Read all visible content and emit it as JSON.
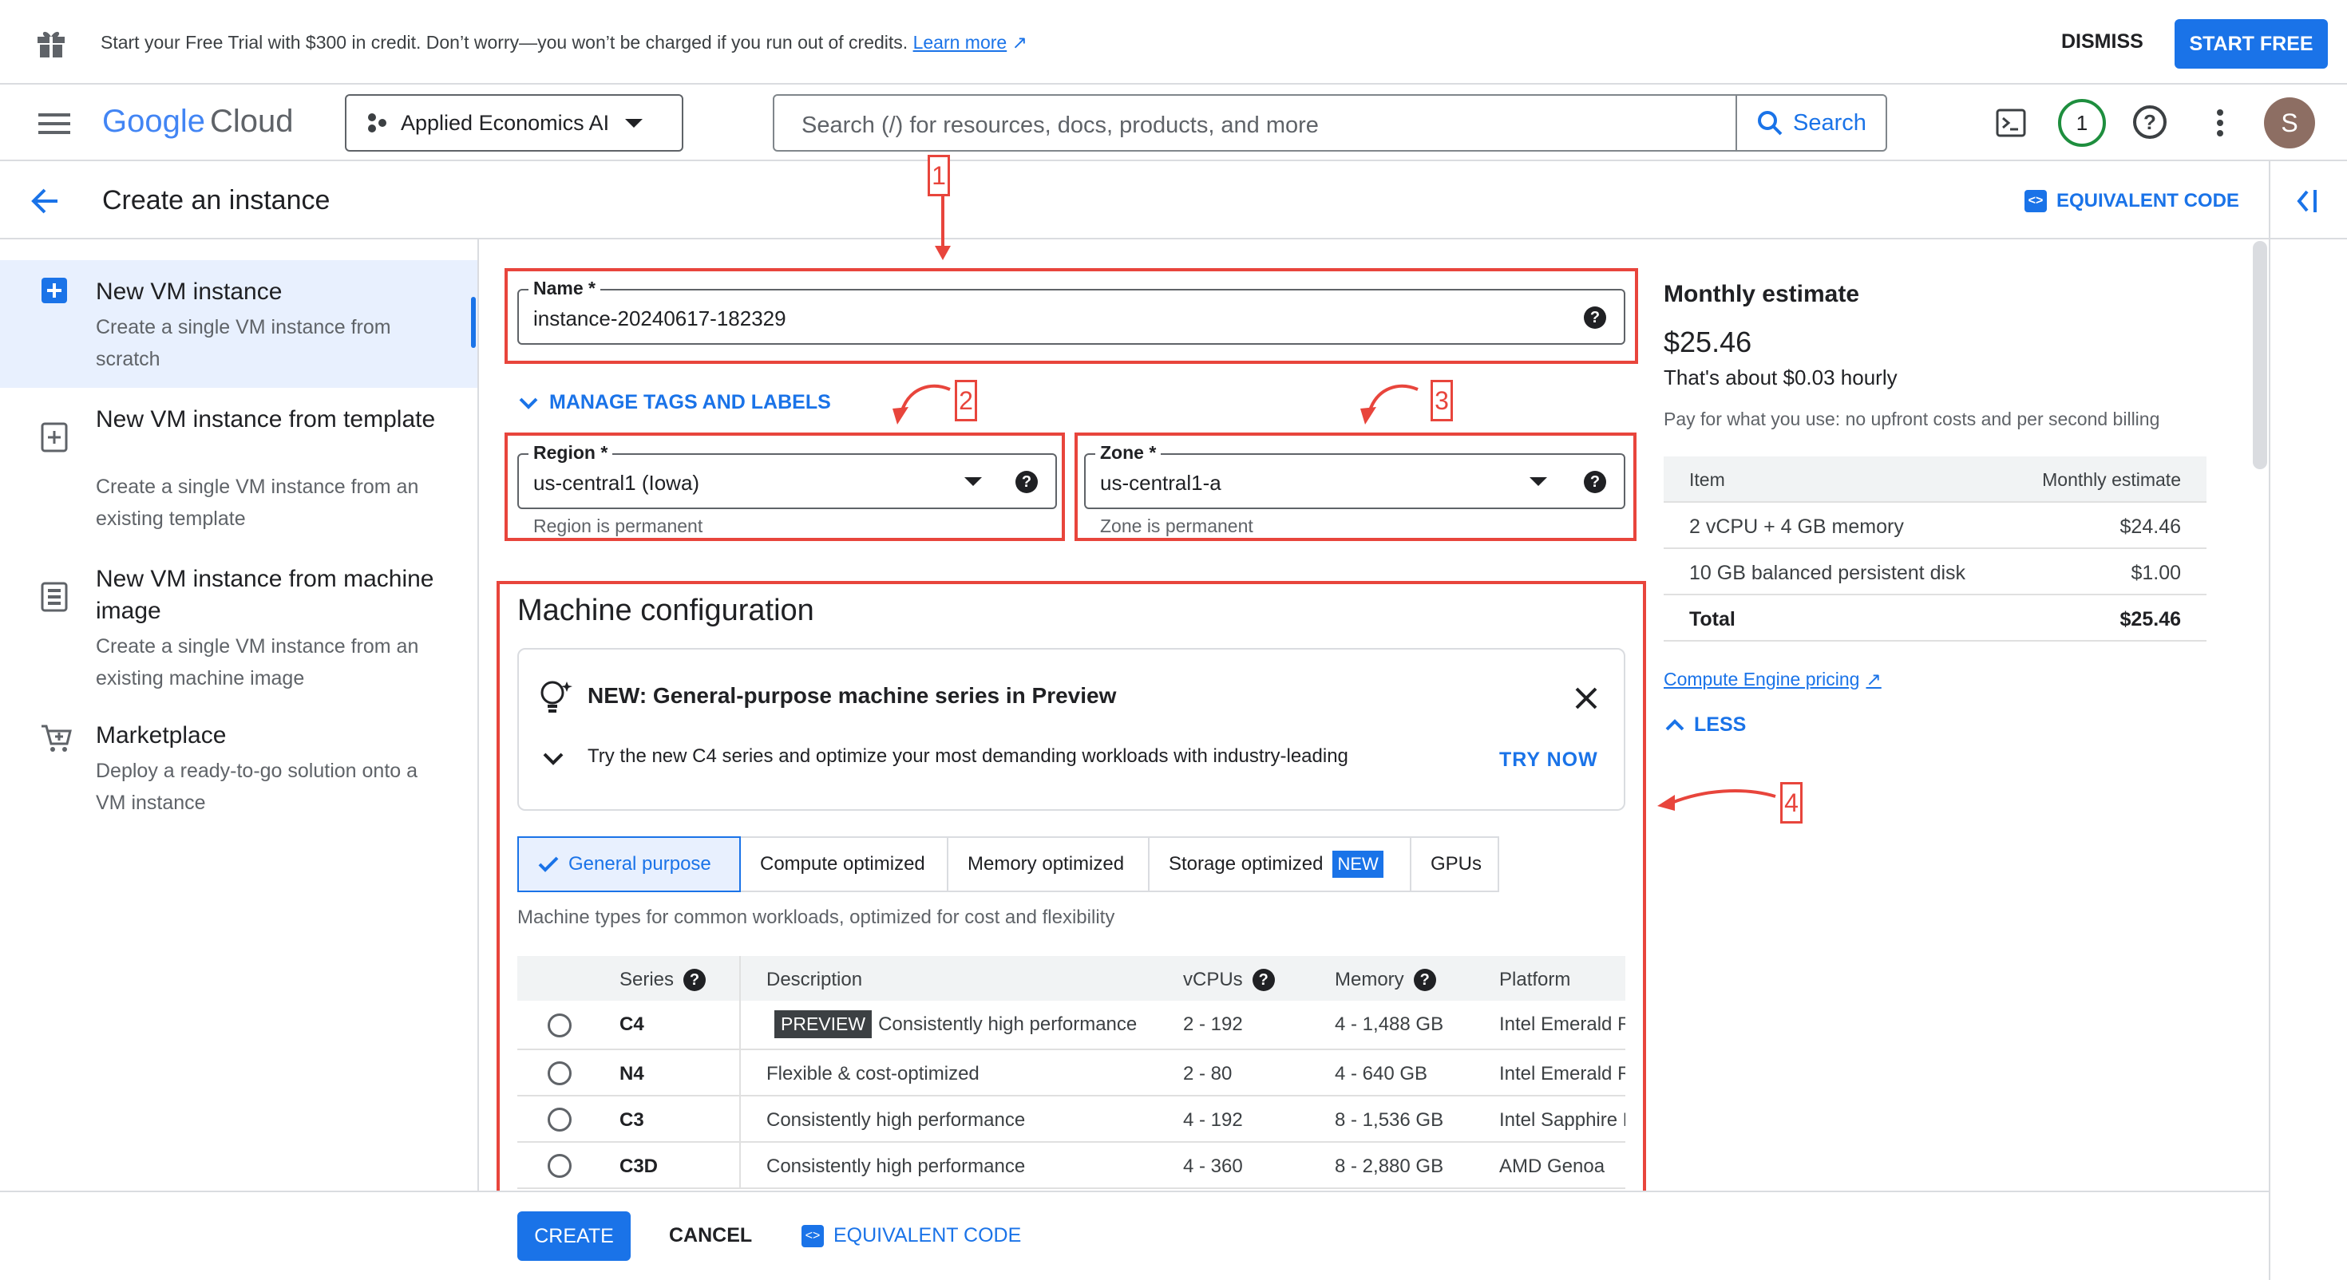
{
  "banner": {
    "message": "Start your Free Trial with $300 in credit. Don’t worry—you won’t be charged if you run out of credits.",
    "learn_more": "Learn more",
    "dismiss": "DISMISS",
    "start_free": "START FREE"
  },
  "header": {
    "logo_google": "Google",
    "logo_cloud": "Cloud",
    "project": "Applied Economics AI",
    "search_placeholder": "Search (/) for resources, docs, products, and more",
    "search_button": "Search",
    "notification_count": "1",
    "avatar_letter": "S"
  },
  "titlebar": {
    "title": "Create an instance",
    "equivalent_code": "EQUIVALENT CODE"
  },
  "nav": [
    {
      "title": "New VM instance",
      "desc": "Create a single VM instance from scratch",
      "icon": "add-box-icon",
      "active": true
    },
    {
      "title": "New VM instance from template",
      "desc": "Create a single VM instance from an existing template",
      "icon": "template-icon"
    },
    {
      "title": "New VM instance from machine image",
      "desc": "Create a single VM instance from an existing machine image",
      "icon": "machine-image-icon"
    },
    {
      "title": "Marketplace",
      "desc": "Deploy a ready-to-go solution onto a VM instance",
      "icon": "cart-icon"
    }
  ],
  "form": {
    "name_label": "Name *",
    "name_value": "instance-20240617-182329",
    "manage_tags": "MANAGE TAGS AND LABELS",
    "region_label": "Region *",
    "region_value": "us-central1 (Iowa)",
    "region_hint": "Region is permanent",
    "zone_label": "Zone *",
    "zone_value": "us-central1-a",
    "zone_hint": "Zone is permanent"
  },
  "annotations": [
    "1",
    "2",
    "3",
    "4"
  ],
  "machine": {
    "title": "Machine configuration",
    "promo_title": "NEW: General-purpose machine series in Preview",
    "promo_desc": "Try the new C4 series and optimize your most demanding workloads with industry-leading",
    "promo_try": "TRY NOW",
    "tabs": [
      "General purpose",
      "Compute optimized",
      "Memory optimized",
      "Storage optimized",
      "GPUs"
    ],
    "new_badge": "NEW",
    "tab_desc": "Machine types for common workloads, optimized for cost and flexibility",
    "columns": [
      "Series",
      "Description",
      "vCPUs",
      "Memory",
      "Platform"
    ],
    "preview_badge": "PREVIEW",
    "rows": [
      {
        "series": "C4",
        "desc": "Consistently high performance",
        "vcpus": "2 - 192",
        "memory": "4 - 1,488 GB",
        "platform": "Intel Emerald R"
      },
      {
        "series": "N4",
        "desc": "Flexible & cost-optimized",
        "vcpus": "2 - 80",
        "memory": "4 - 640 GB",
        "platform": "Intel Emerald R"
      },
      {
        "series": "C3",
        "desc": "Consistently high performance",
        "vcpus": "4 - 192",
        "memory": "8 - 1,536 GB",
        "platform": "Intel Sapphire F"
      },
      {
        "series": "C3D",
        "desc": "Consistently high performance",
        "vcpus": "4 - 360",
        "memory": "8 - 2,880 GB",
        "platform": "AMD Genoa"
      }
    ]
  },
  "estimate": {
    "title": "Monthly estimate",
    "price": "$25.46",
    "hourly": "That's about $0.03 hourly",
    "pay": "Pay for what you use: no upfront costs and per second billing",
    "head_item": "Item",
    "head_monthly": "Monthly estimate",
    "rows": [
      {
        "item": "2 vCPU + 4 GB memory",
        "cost": "$24.46"
      },
      {
        "item": "10 GB balanced persistent disk",
        "cost": "$1.00"
      },
      {
        "item": "Total",
        "cost": "$25.46"
      }
    ],
    "pricing_link": "Compute Engine pricing",
    "less": "LESS"
  },
  "footer": {
    "create": "CREATE",
    "cancel": "CANCEL",
    "equivalent_code": "EQUIVALENT CODE"
  },
  "colors": {
    "accent": "#1a73e8",
    "annotation": "#e8453c"
  }
}
